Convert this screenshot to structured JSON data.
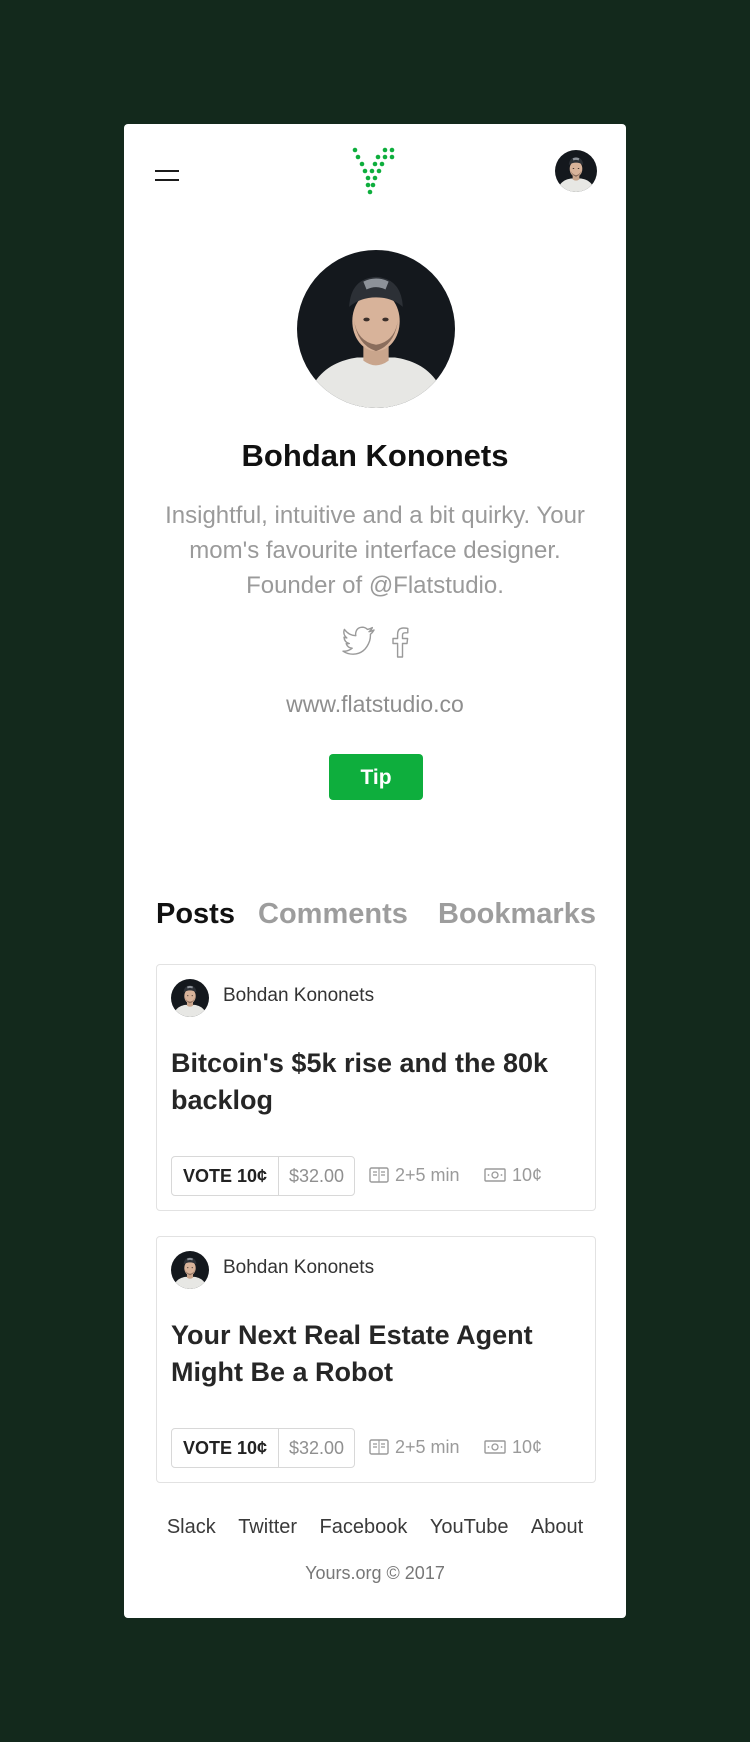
{
  "header": {
    "menu_icon": "hamburger-menu-icon",
    "logo_icon": "yours-logo-icon",
    "avatar_icon": "user-avatar-icon"
  },
  "profile": {
    "name": "Bohdan Kononets",
    "bio": "Insightful, intuitive and a bit quirky. Your mom's favourite interface designer. Founder of @Flatstudio.",
    "website": "www.flatstudio.co",
    "tip_label": "Tip",
    "social_icons": [
      "twitter-icon",
      "facebook-icon"
    ]
  },
  "tabs": [
    {
      "label": "Posts",
      "active": true
    },
    {
      "label": "Comments",
      "active": false
    },
    {
      "label": "Bookmarks",
      "active": false
    }
  ],
  "posts": [
    {
      "author": "Bohdan Kononets",
      "title": "Bitcoin's $5k rise and the 80k backlog",
      "vote_label": "VOTE 10¢",
      "vote_amount": "$32.00",
      "read_time": "2+5 min",
      "price": "10¢"
    },
    {
      "author": "Bohdan Kononets",
      "title": "Your Next Real Estate Agent Might Be a Robot",
      "vote_label": "VOTE 10¢",
      "vote_amount": "$32.00",
      "read_time": "2+5 min",
      "price": "10¢"
    }
  ],
  "footer": {
    "links": [
      "Slack",
      "Twitter",
      "Facebook",
      "YouTube",
      "About"
    ],
    "copyright": "Yours.org © 2017"
  },
  "colors": {
    "page_background": "#13291c",
    "accent_green": "#0eae3d"
  }
}
